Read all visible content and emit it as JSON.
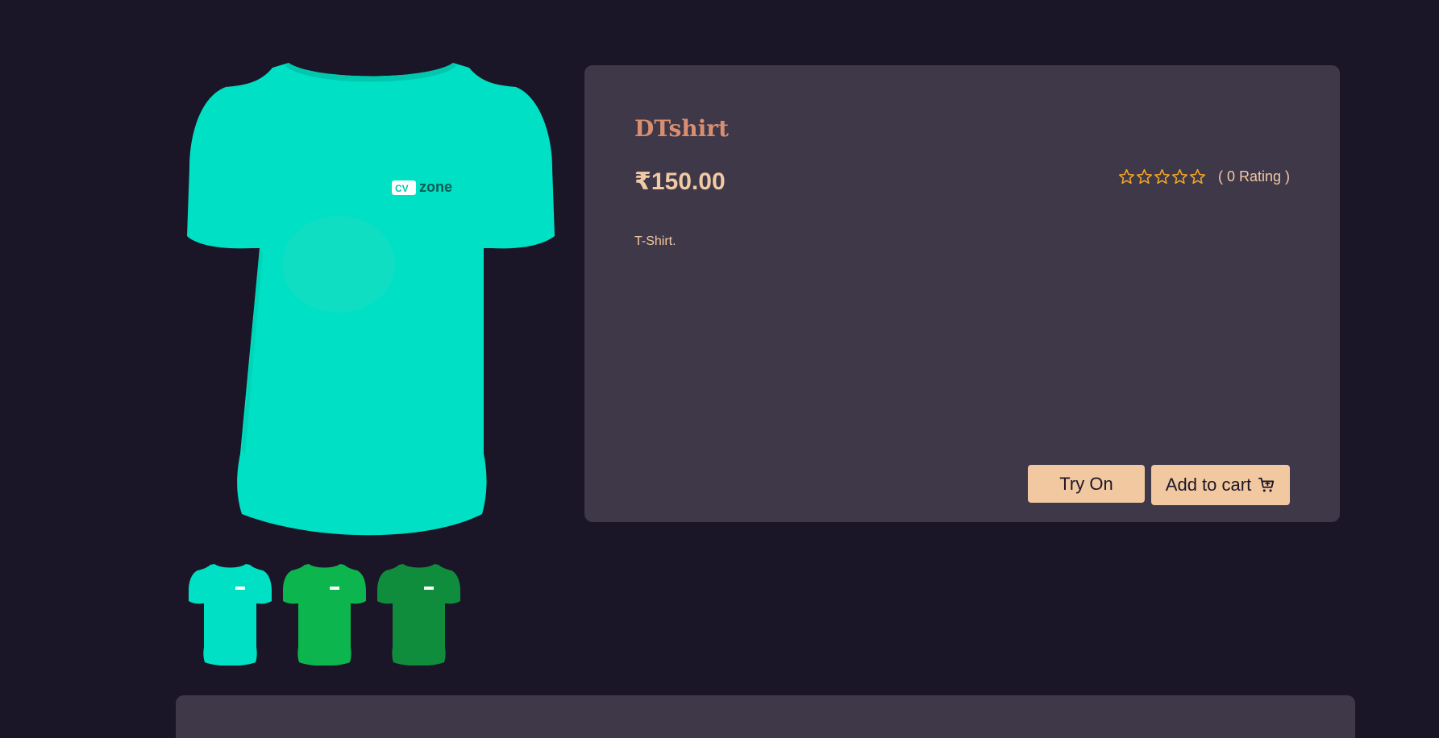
{
  "product": {
    "name": "DTshirt",
    "price": "₹150.00",
    "rating_text": "( 0 Rating )",
    "rating_value": 0,
    "rating_max": 5,
    "description": "T-Shirt.",
    "main_image_logo_text": "CV zone"
  },
  "gallery": {
    "thumbnails": [
      {
        "color": "#00e0c4",
        "alt": "Teal T-Shirt"
      },
      {
        "color": "#0cb54d",
        "alt": "Green T-Shirt"
      },
      {
        "color": "#0f8c3c",
        "alt": "Dark Green T-Shirt"
      }
    ]
  },
  "actions": {
    "try_on_label": "Try On",
    "add_to_cart_label": "Add to cart"
  },
  "icons": {
    "rating_star": "star-outline-icon",
    "cart": "shopping-cart-icon"
  },
  "colors": {
    "background": "#1b1627",
    "card": "#3f3849",
    "title": "#d98f6f",
    "text": "#f1c9a3",
    "button": "#f2c8a0",
    "star": "#f5a623",
    "main_shirt": "#00e0c4"
  }
}
